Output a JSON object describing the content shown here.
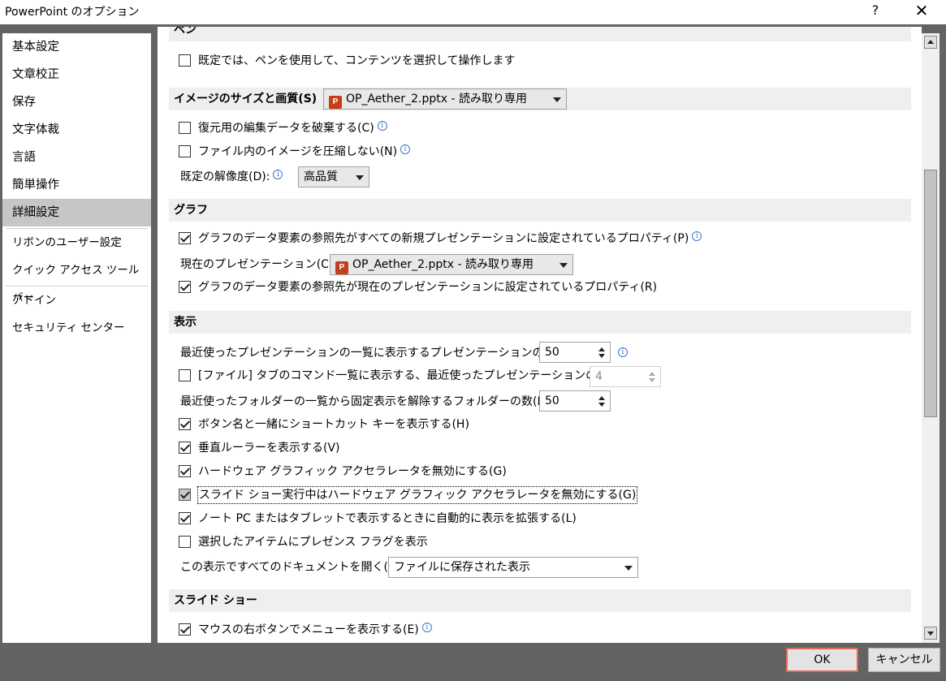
{
  "window": {
    "title": "PowerPoint のオプション",
    "help": "?",
    "close": "✕"
  },
  "sidebar": {
    "items": [
      {
        "label": "基本設定"
      },
      {
        "label": "文章校正"
      },
      {
        "label": "保存"
      },
      {
        "label": "文字体裁"
      },
      {
        "label": "言語"
      },
      {
        "label": "簡単操作"
      },
      {
        "label": "詳細設定",
        "selected": true
      },
      {
        "label": "リボンのユーザー設定"
      },
      {
        "label": "クイック アクセス ツール バー"
      },
      {
        "label": "アドイン"
      },
      {
        "label": "セキュリティ センター"
      }
    ]
  },
  "pen": {
    "header": "ペン",
    "select_with_pen": {
      "label": "既定では、ペンを使用して、コンテンツを選択して操作します",
      "checked": false
    }
  },
  "image_quality": {
    "header": "イメージのサイズと画質(S)",
    "file": "OP_Aether_2.pptx - 読み取り専用",
    "discard_editing_data": {
      "label": "復元用の編集データを破棄する(C)",
      "checked": false
    },
    "no_compress": {
      "label": "ファイル内のイメージを圧縮しない(N)",
      "checked": false
    },
    "resolution_label": "既定の解像度(D):",
    "resolution_value": "高品質"
  },
  "chart": {
    "header": "グラフ",
    "props_all_new": {
      "label": "グラフのデータ要素の参照先がすべての新規プレゼンテーションに設定されているプロパティ(P)",
      "checked": true
    },
    "current_label": "現在のプレゼンテーション(C):",
    "current_file": "OP_Aether_2.pptx - 読み取り専用",
    "props_current": {
      "label": "グラフのデータ要素の参照先が現在のプレゼンテーションに設定されているプロパティ(R)",
      "checked": true
    }
  },
  "display": {
    "header": "表示",
    "recent_presentations": {
      "label": "最近使ったプレゼンテーションの一覧に表示するプレゼンテーションの数(R):",
      "value": "50"
    },
    "file_tab_recent": {
      "label": "[ファイル] タブのコマンド一覧に表示する、最近使ったプレゼンテーションの数(Q):",
      "value": "4",
      "checked": false
    },
    "recent_folders": {
      "label": "最近使ったフォルダーの一覧から固定表示を解除するフォルダーの数(F):",
      "value": "50"
    },
    "shortcut_keys": {
      "label": "ボタン名と一緒にショートカット キーを表示する(H)",
      "checked": true
    },
    "vertical_ruler": {
      "label": "垂直ルーラーを表示する(V)",
      "checked": true
    },
    "disable_hw_accel": {
      "label": "ハードウェア グラフィック アクセラレータを無効にする(G)",
      "checked": true
    },
    "slideshow_hw_accel": {
      "label": "スライド ショー実行中はハードウェア グラフィック アクセラレータを無効にする(G)",
      "checked": true
    },
    "auto_zoom": {
      "label": "ノート PC またはタブレットで表示するときに自動的に表示を拡張する(L)",
      "checked": true
    },
    "presence_flags": {
      "label": "選択したアイテムにプレゼンス フラグを表示",
      "checked": false
    },
    "open_all_label": "この表示ですべてのドキュメントを開く(O):",
    "open_all_value": "ファイルに保存された表示"
  },
  "slideshow": {
    "header": "スライド ショー",
    "right_click_menu": {
      "label": "マウスの右ボタンでメニューを表示する(E)",
      "checked": true
    }
  },
  "buttons": {
    "ok": "OK",
    "cancel": "キャンセル"
  },
  "icons": {
    "info": "i",
    "ppt": "P"
  },
  "colors": {
    "ok_border": "#e06a54",
    "selected_item": "#c6c6c6",
    "info_icon": "#3b78c8",
    "ppt_icon": "#c43e1c"
  }
}
